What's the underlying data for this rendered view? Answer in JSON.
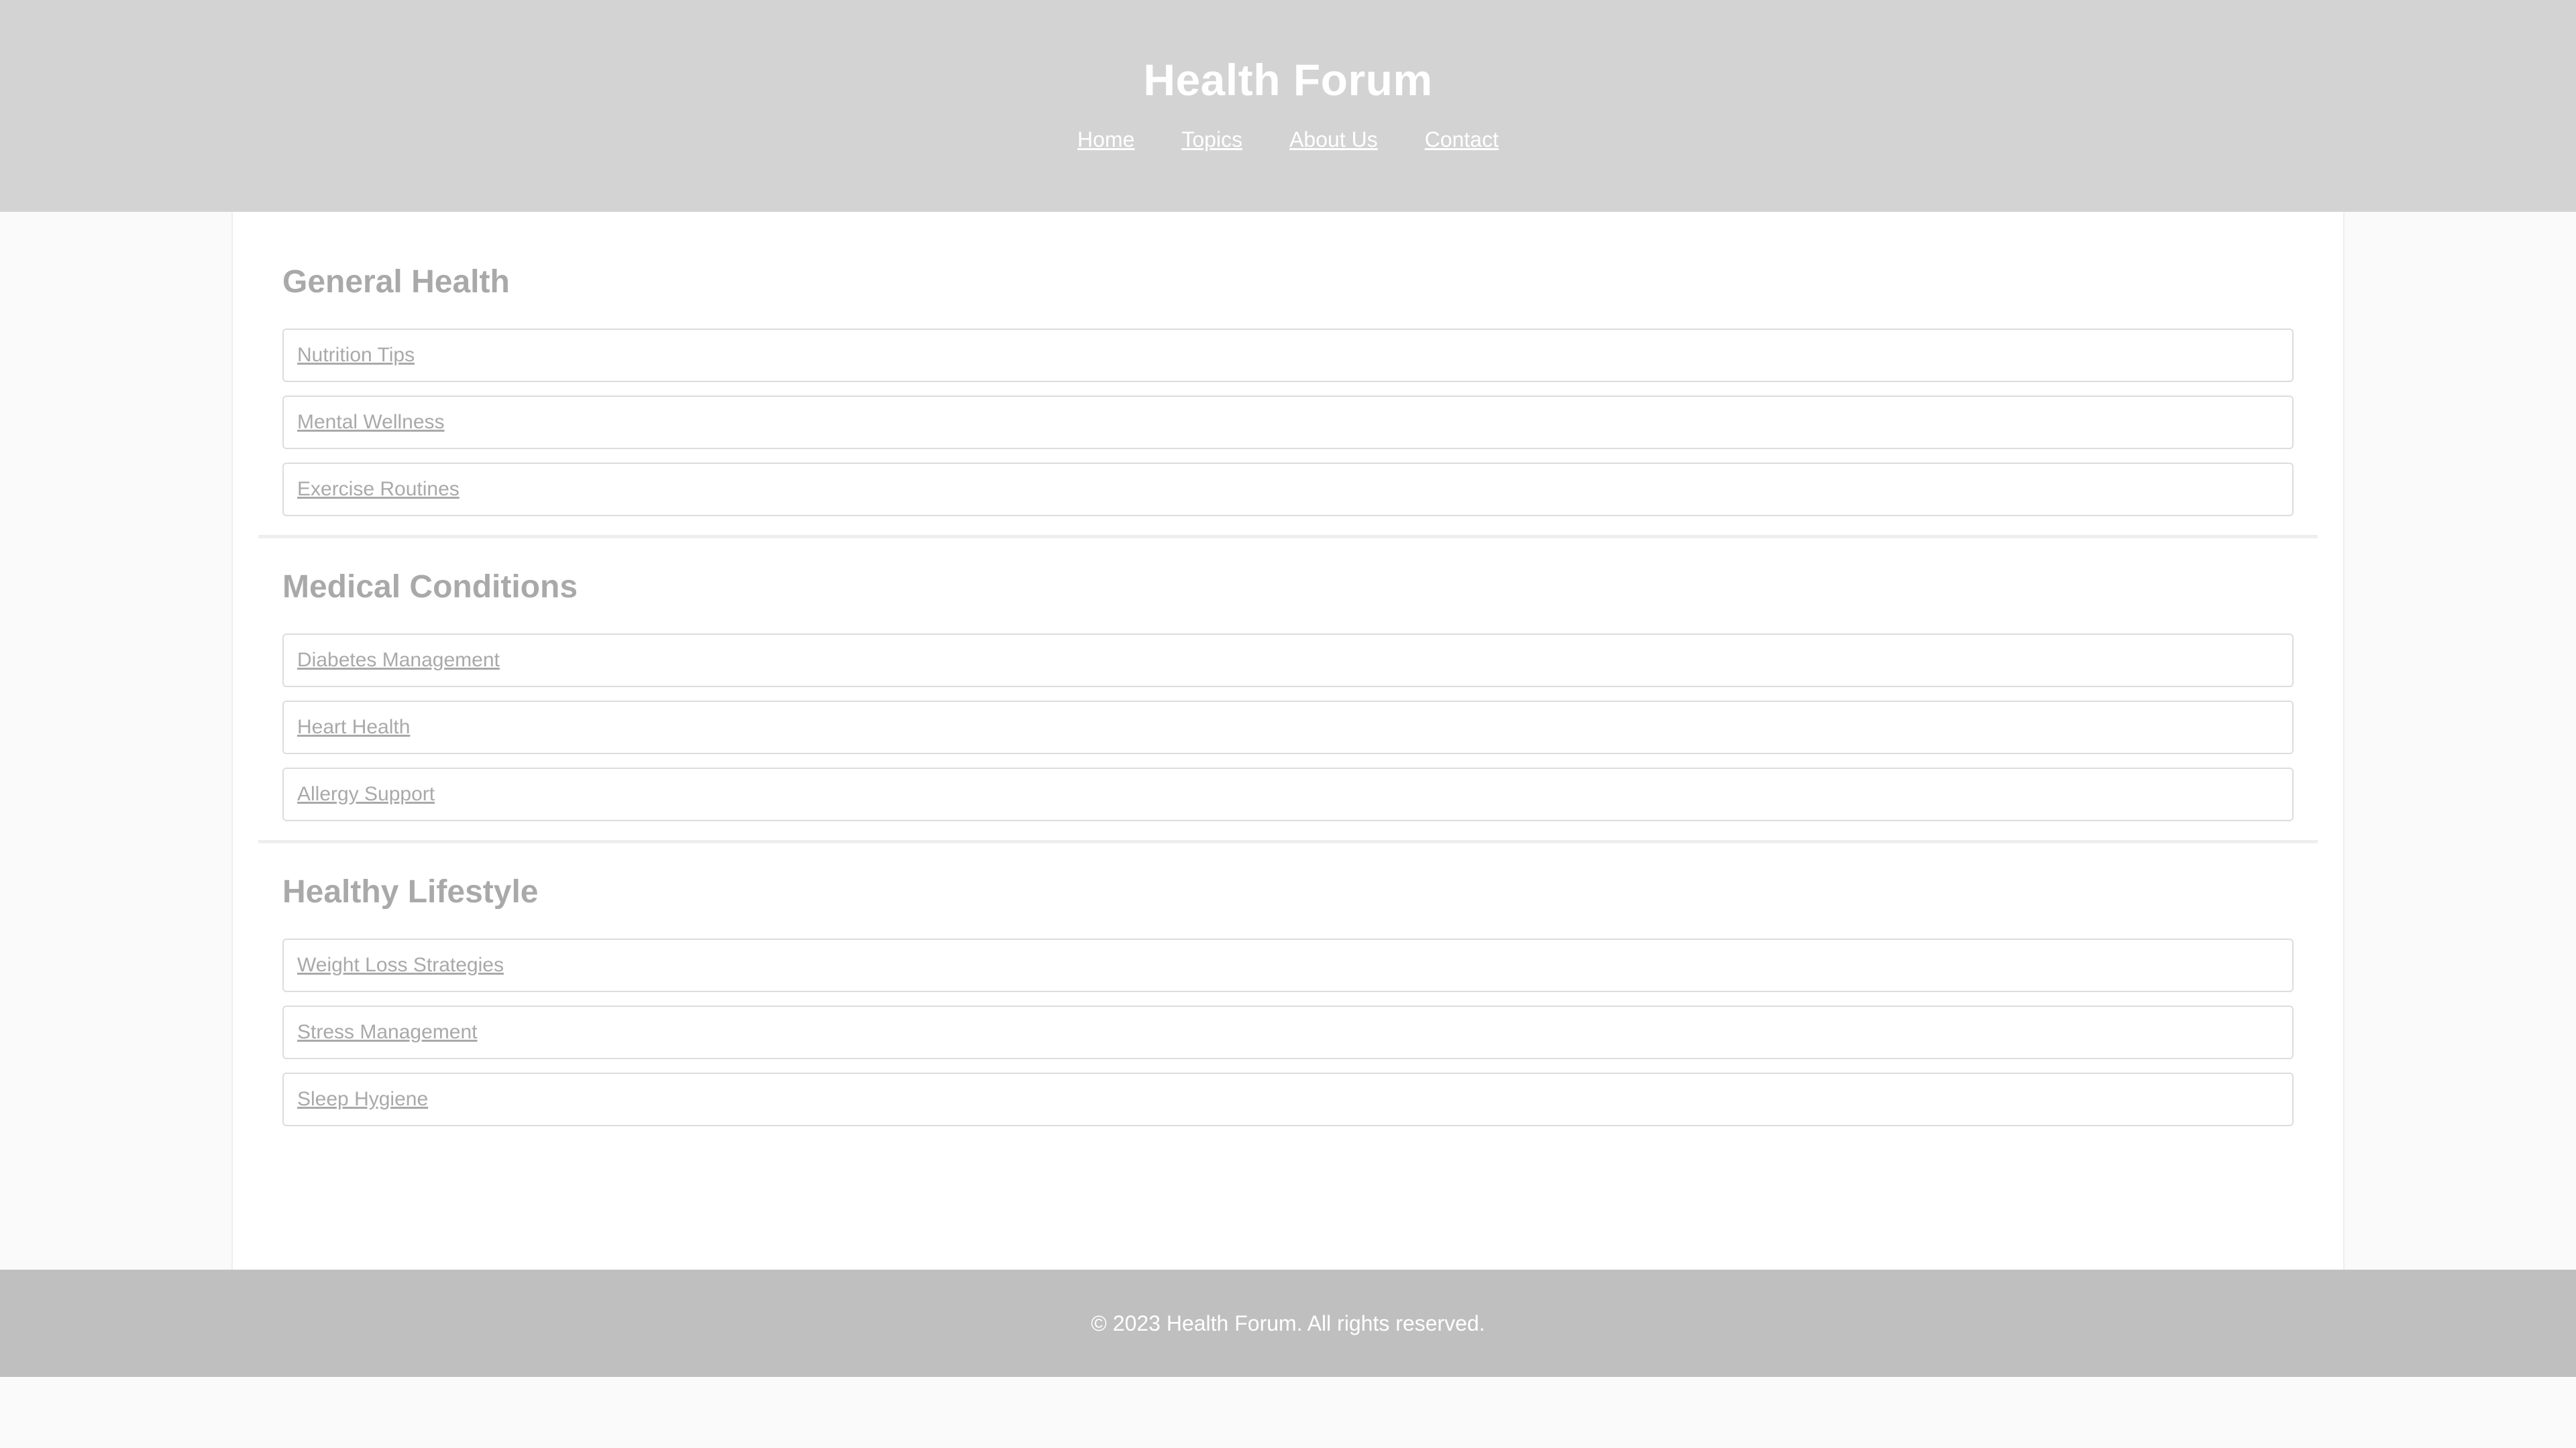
{
  "header": {
    "title": "Health Forum",
    "nav": [
      {
        "label": "Home"
      },
      {
        "label": "Topics"
      },
      {
        "label": "About Us"
      },
      {
        "label": "Contact"
      }
    ]
  },
  "sections": [
    {
      "heading": "General Health",
      "topics": [
        {
          "label": "Nutrition Tips"
        },
        {
          "label": "Mental Wellness"
        },
        {
          "label": "Exercise Routines"
        }
      ]
    },
    {
      "heading": "Medical Conditions",
      "topics": [
        {
          "label": "Diabetes Management"
        },
        {
          "label": "Heart Health"
        },
        {
          "label": "Allergy Support"
        }
      ]
    },
    {
      "heading": "Healthy Lifestyle",
      "topics": [
        {
          "label": "Weight Loss Strategies"
        },
        {
          "label": "Stress Management"
        },
        {
          "label": "Sleep Hygiene"
        }
      ]
    }
  ],
  "footer": {
    "text": "© 2023 Health Forum. All rights reserved."
  },
  "colors": {
    "header_bg": "#d3d3d3",
    "footer_bg": "#bfbfbf",
    "text_muted": "#a9a9a9",
    "page_bg": "#fafafa"
  }
}
